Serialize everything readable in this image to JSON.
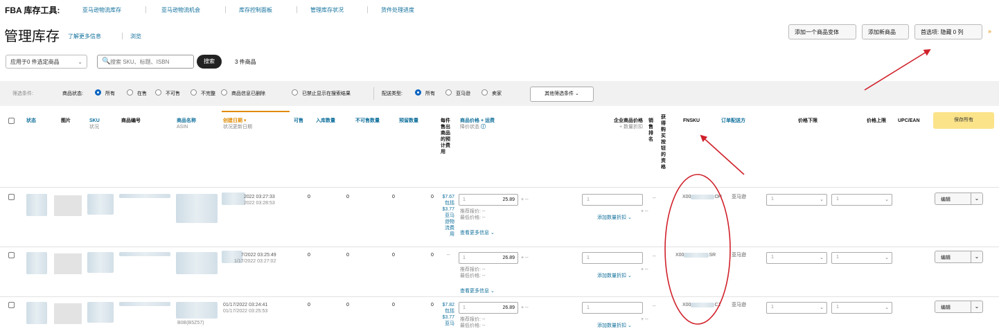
{
  "nav": {
    "title": "FBA 库存工具:",
    "links": [
      "亚马逊物流库存",
      "亚马逊物流机会",
      "库存控制面板",
      "管理库存状况",
      "货件处理进度"
    ]
  },
  "page": {
    "title": "管理库存",
    "learn_more": "了解更多信息",
    "tour": "浏览"
  },
  "top_buttons": {
    "add_variation": "添加一个商品变体",
    "add_product": "添加新商品",
    "preferences": "首选项: 隐藏 0 列"
  },
  "toolbar": {
    "apply_select": "应用于0 件选定商品",
    "search_placeholder": "搜索 SKU、标题、ISBN",
    "search_button": "搜索",
    "item_count": "3 件商品"
  },
  "filters": {
    "label": "筛选条件:",
    "status_label": "商品状态:",
    "status_options": [
      "所有",
      "在售",
      "不可售",
      "不完整",
      "商品信息已删除",
      "已禁止显示在搜索结果"
    ],
    "fulfillment_label": "配送类型:",
    "fulfillment_options": [
      "所有",
      "亚马逊",
      "卖家"
    ],
    "more_filters": "其他筛选条件"
  },
  "columns": {
    "status": "状态",
    "image": "图片",
    "sku": "SKU",
    "sku_sub": "状况",
    "product_id": "商品编号",
    "product_name": "商品名称",
    "product_name_sub": "ASIN",
    "date_created": "创建日期",
    "date_created_sub": "状况更新日期",
    "available": "可售",
    "inbound": "入库数量",
    "unfulfillable": "不可售数量",
    "reserved": "预留数量",
    "fee_preview": "每件售出商品的预计费用",
    "price": "商品价格 + 运费",
    "price_sub": "降价状态",
    "business_price": "企业商品价格",
    "business_price_sub": "+ 数量折扣",
    "sales_rank": "销售排名",
    "buybox": "获得购买按钮的资格",
    "fnsku": "FNSKU",
    "fulfillment": "订单配送方",
    "min_price": "价格下限",
    "max_price": "价格上限",
    "upc": "UPC/EAN",
    "save_all": "保存所有"
  },
  "rows": [
    {
      "date1": "2022 03:27:33",
      "date2": "2022 03:28:53",
      "available": "0",
      "inbound": "0",
      "unfulfillable": "0",
      "reserved": "0",
      "fee_lines": [
        "$7.67",
        "包括",
        "$3.77",
        "亚马",
        "逊物",
        "流费",
        "用"
      ],
      "price": "25.89",
      "lowest": "推荐报价: --",
      "buybox": "最低价格: --",
      "more_info": "查看更多信息",
      "business_qty": "1",
      "add_discount": "添加数量折扣",
      "fnsku_prefix": "X00",
      "fnsku_suffix": "OH",
      "fulfillment": "亚马逊",
      "edit": "编辑"
    },
    {
      "date1": "7/2022 03:25:49",
      "date2": "1/17/2022 03:27:02",
      "available": "0",
      "inbound": "0",
      "unfulfillable": "0",
      "reserved": "0",
      "fee_lines": [
        "--"
      ],
      "price": "26.89",
      "lowest": "推荐报价: --",
      "buybox": "最低价格: --",
      "more_info": "查看更多信息",
      "business_qty": "1",
      "add_discount": "添加数量折扣",
      "fnsku_prefix": "X00",
      "fnsku_suffix": "SR",
      "fulfillment": "亚马逊",
      "edit": "编辑"
    },
    {
      "date1": "01/17/2022 03:24:41",
      "date2": "01/17/2022 03:25:53",
      "available": "0",
      "inbound": "0",
      "unfulfillable": "0",
      "reserved": "0",
      "fee_lines": [
        "$7.82",
        "包括",
        "$3.77",
        "亚马"
      ],
      "price": "26.89",
      "lowest": "推荐报价: --",
      "buybox": "最低价格: --",
      "more_info": "",
      "business_qty": "1",
      "add_discount": "添加数量折扣",
      "fnsku_prefix": "X00",
      "fnsku_suffix": "C1",
      "fulfillment": "亚马逊",
      "edit": "编辑",
      "asin_tail": "B0B(B5Z57)"
    }
  ],
  "annotation_color": "#d0202a",
  "accent_color": "#0f6f9b"
}
